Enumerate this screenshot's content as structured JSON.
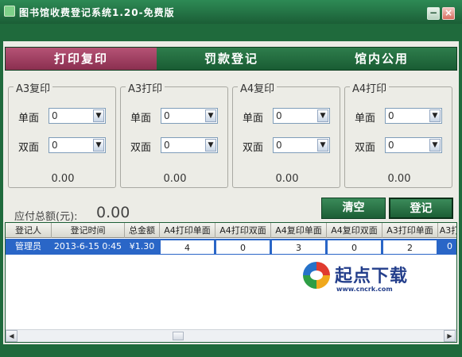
{
  "window": {
    "title": "图书馆收费登记系统1.20-免费版",
    "minimize_label": "−",
    "close_label": "×"
  },
  "tabs": [
    {
      "label": "打印复印",
      "active": true
    },
    {
      "label": "罚款登记",
      "active": false
    },
    {
      "label": "馆内公用",
      "active": false
    }
  ],
  "panels": [
    {
      "title": "A3复印",
      "single_label": "单面",
      "single_value": "0",
      "double_label": "双面",
      "double_value": "0",
      "total": "0.00"
    },
    {
      "title": "A3打印",
      "single_label": "单面",
      "single_value": "0",
      "double_label": "双面",
      "double_value": "0",
      "total": "0.00"
    },
    {
      "title": "A4复印",
      "single_label": "单面",
      "single_value": "0",
      "double_label": "双面",
      "double_value": "0",
      "total": "0.00"
    },
    {
      "title": "A4打印",
      "single_label": "单面",
      "single_value": "0",
      "double_label": "双面",
      "double_value": "0",
      "total": "0.00"
    }
  ],
  "summary": {
    "total_label": "应付总额(元):",
    "total_value": "0.00"
  },
  "buttons": {
    "clear": "清空",
    "register": "登记"
  },
  "table": {
    "columns": [
      "登记人",
      "登记时间",
      "总金额",
      "A4打印单面",
      "A4打印双面",
      "A4复印单面",
      "A4复印双面",
      "A3打印单面",
      "A3打"
    ],
    "rows": [
      [
        "管理员",
        "2013-6-15 0:45",
        "¥1.30",
        "4",
        "0",
        "3",
        "0",
        "2",
        "0"
      ]
    ]
  },
  "watermark": {
    "text": "起点下载",
    "url": "www.cncrk.com"
  },
  "colors": {
    "window_green": "#1f6a3c",
    "active_tab": "#9b3c5f",
    "selected_row": "#2a66c7",
    "content_bg": "#ecece6"
  },
  "icons": {
    "app": "library-app-icon",
    "combo": "chevron-down-icon",
    "scroll_left": "arrow-left-icon",
    "scroll_right": "arrow-right-icon"
  }
}
